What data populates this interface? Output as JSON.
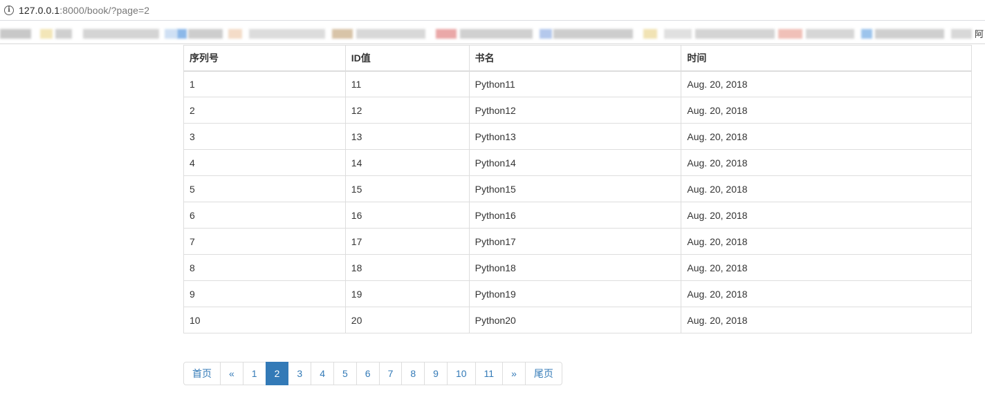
{
  "browser": {
    "url_host": "127.0.0.1",
    "url_path": ":8000/book/?page=2",
    "bookmark_edge_char": "阿"
  },
  "table": {
    "headers": [
      "序列号",
      "ID值",
      "书名",
      "时间"
    ],
    "rows": [
      [
        "1",
        "11",
        "Python11",
        "Aug. 20, 2018"
      ],
      [
        "2",
        "12",
        "Python12",
        "Aug. 20, 2018"
      ],
      [
        "3",
        "13",
        "Python13",
        "Aug. 20, 2018"
      ],
      [
        "4",
        "14",
        "Python14",
        "Aug. 20, 2018"
      ],
      [
        "5",
        "15",
        "Python15",
        "Aug. 20, 2018"
      ],
      [
        "6",
        "16",
        "Python16",
        "Aug. 20, 2018"
      ],
      [
        "7",
        "17",
        "Python17",
        "Aug. 20, 2018"
      ],
      [
        "8",
        "18",
        "Python18",
        "Aug. 20, 2018"
      ],
      [
        "9",
        "19",
        "Python19",
        "Aug. 20, 2018"
      ],
      [
        "10",
        "20",
        "Python20",
        "Aug. 20, 2018"
      ]
    ]
  },
  "pagination": {
    "first_label": "首页",
    "prev_label": "«",
    "pages": [
      "1",
      "2",
      "3",
      "4",
      "5",
      "6",
      "7",
      "8",
      "9",
      "10",
      "11"
    ],
    "active_page": "2",
    "next_label": "»",
    "last_label": "尾页"
  },
  "colors": {
    "accent": "#337ab7",
    "border": "#dddddd",
    "text": "#333333"
  }
}
